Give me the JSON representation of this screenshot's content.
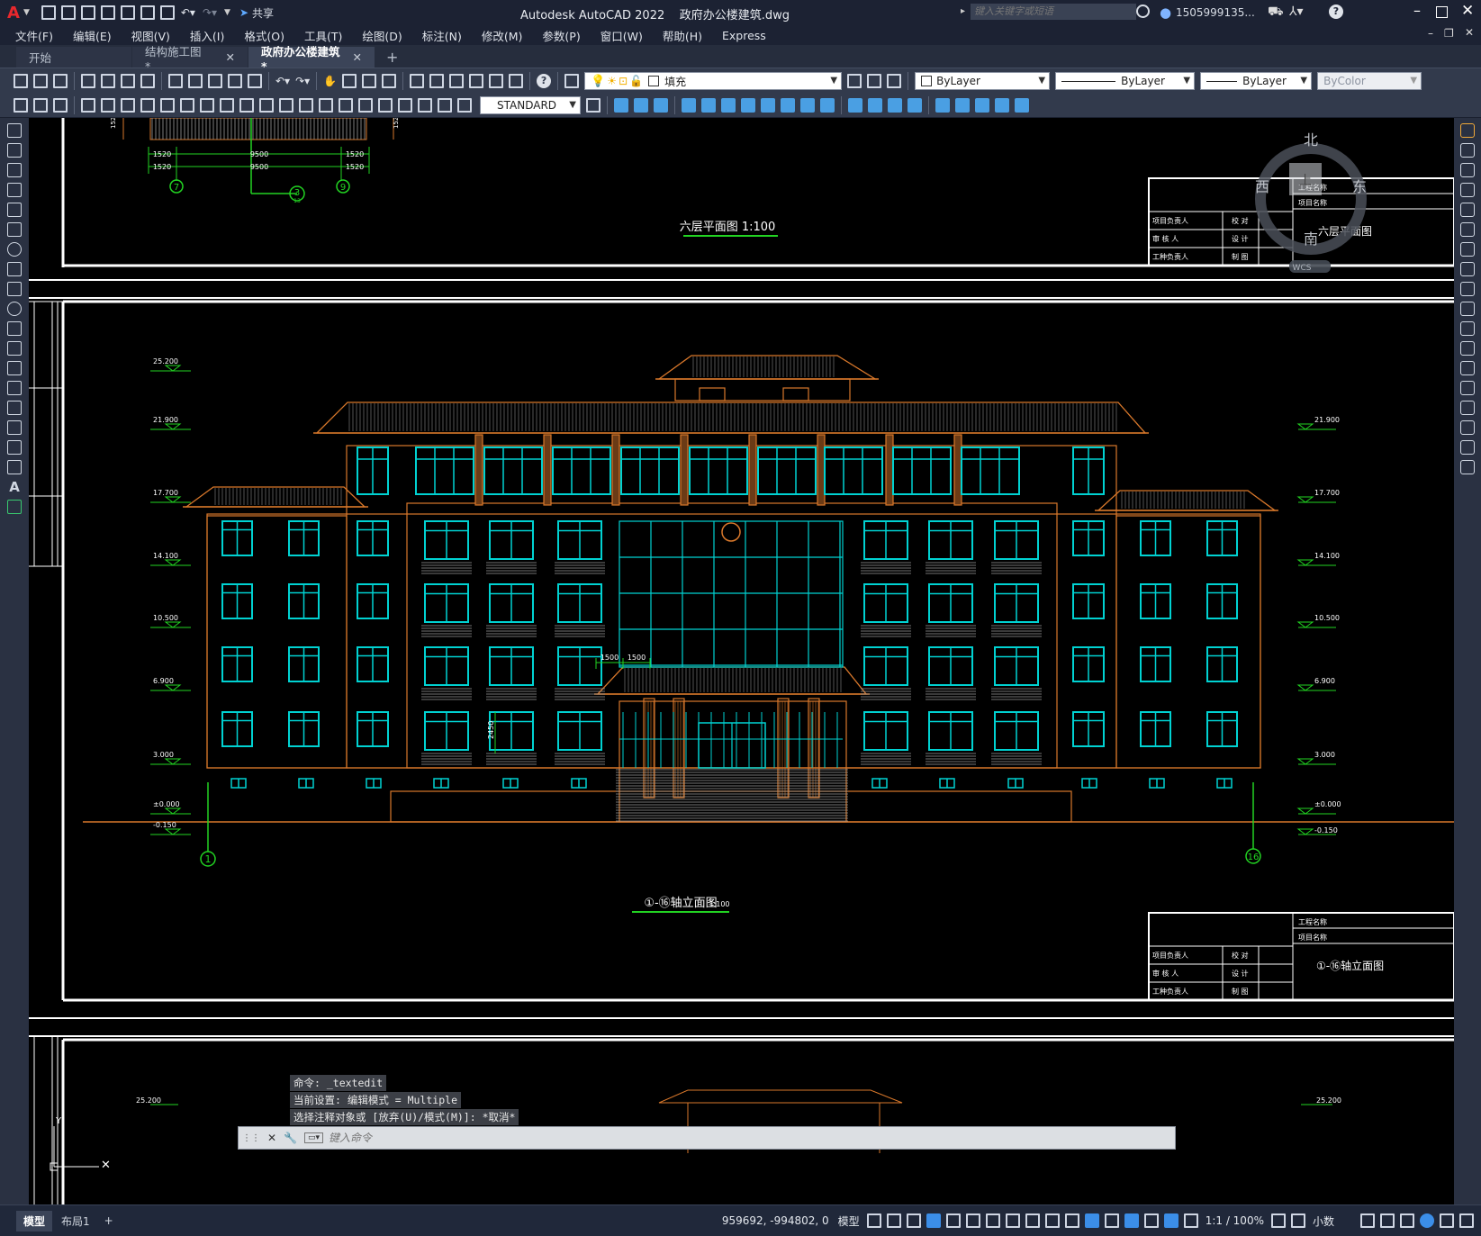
{
  "titlebar": {
    "app_title": "Autodesk AutoCAD 2022    政府办公楼建筑.dwg",
    "share": "共享",
    "search_placeholder": "键入关键字或短语",
    "user": "1505999135...",
    "window_controls": [
      "minimize-icon",
      "maximize-icon",
      "close-icon"
    ]
  },
  "menu": [
    "文件(F)",
    "编辑(E)",
    "视图(V)",
    "插入(I)",
    "格式(O)",
    "工具(T)",
    "绘图(D)",
    "标注(N)",
    "修改(M)",
    "参数(P)",
    "窗口(W)",
    "帮助(H)",
    "Express"
  ],
  "tabs": [
    {
      "label": "开始",
      "active": false,
      "closable": false
    },
    {
      "label": "结构施工图*",
      "active": false,
      "closable": true
    },
    {
      "label": "政府办公楼建筑*",
      "active": true,
      "closable": true
    }
  ],
  "toolbar1": {
    "layer_combo": "填充",
    "color_combo": "ByLayer",
    "linetype_combo": "ByLayer",
    "lineweight_combo": "ByLayer",
    "plotstyle_combo": "ByColor"
  },
  "toolbar2": {
    "textstyle_combo": "STANDARD"
  },
  "viewcube": {
    "north": "北",
    "south": "南",
    "east": "东",
    "west": "西",
    "top": "上",
    "wcs": "WCS"
  },
  "drawing": {
    "plan_title": "六层平面图 1:100",
    "plan_dims_row1": [
      "1520",
      "9500",
      "1520"
    ],
    "plan_dims_row2": [
      "1520",
      "9500",
      "1520"
    ],
    "plan_axes": [
      "7",
      "3",
      "9"
    ],
    "plan_axis_sub": "13",
    "titleblock_a_title": "六层平面图",
    "titleblock_rows_left": [
      "项目负责人",
      "审 核 人",
      "工种负责人"
    ],
    "titleblock_rows_mid": [
      "校 对",
      "设 计",
      "制 图"
    ],
    "titleblock_rows_top": [
      "工程名称",
      "项目名称"
    ],
    "elevation_title": "①-⑯轴立面图",
    "elevation_scale": "1:100",
    "titleblock_b_title": "①-⑯轴立面图",
    "levels": [
      "25.200",
      "21.900",
      "17.700",
      "14.100",
      "10.500",
      "6.900",
      "3.000",
      "±0.000",
      "-0.150"
    ],
    "left_axis": "1",
    "right_axis": "16",
    "dim_1500_a": "1500",
    "dim_1500_b": "1500",
    "dim_2450": "2450",
    "bottom_level": "25.200"
  },
  "command": {
    "line1": "命令: _textedit",
    "line2": "当前设置: 编辑模式 = Multiple",
    "line3": "选择注释对象或 [放弃(U)/模式(M)]: *取消*",
    "placeholder": "键入命令"
  },
  "statusbar": {
    "layout_tabs": [
      "模型",
      "布局1"
    ],
    "coords": "959692, -994802, 0",
    "model": "模型",
    "scale": "1:1 / 100%",
    "units": "小数"
  },
  "colors": {
    "orange": "#d9782b",
    "cyan": "#00d2d2",
    "green": "#22d322",
    "white": "#ffffff"
  }
}
